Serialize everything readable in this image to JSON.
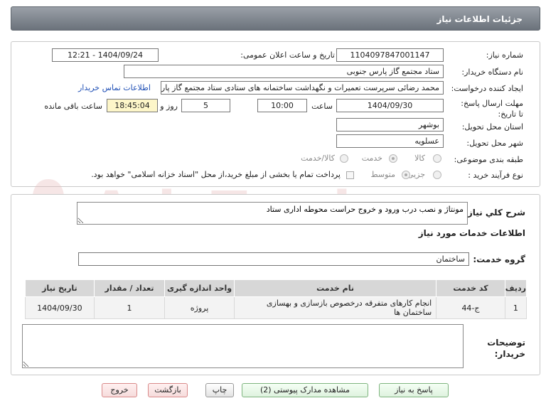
{
  "window": {
    "title": "جزئیات اطلاعات نیاز"
  },
  "fields": {
    "need_number_label": "شماره نیاز:",
    "need_number": "1104097847001147",
    "announce_label": "تاریخ و ساعت اعلان عمومی:",
    "announce_value": "1404/09/24 - 12:21",
    "buyer_org_label": "نام دستگاه خریدار:",
    "buyer_org": "ستاد مجتمع گاز پارس جنوبی",
    "creator_label": "ایجاد کننده درخواست:",
    "creator": "محمد رضائی سرپرست تعمیرات و نگهداشت ساختمانه های ستادی ستاد مجتمع گاز پارس جنوبی",
    "contact_link": "اطلاعات تماس خریدار",
    "deadline_label": "مهلت ارسال پاسخ: تا تاریخ:",
    "deadline_date": "1404/09/30",
    "time_label": "ساعت",
    "deadline_time": "10:00",
    "days_value": "5",
    "days_label": "روز و",
    "remaining_time": "18:45:04",
    "remaining_label": "ساعت باقی مانده",
    "province_label": "استان محل تحویل:",
    "province": "بوشهر",
    "city_label": "شهر محل تحویل:",
    "city": "عسلویه",
    "category_label": "طبقه بندی موضوعی:",
    "category_options": [
      "کالا",
      "خدمت",
      "کالا/خدمت"
    ],
    "category_selected": "خدمت",
    "process_label": "نوع فرآیند خرید :",
    "process_options": [
      "جزیی",
      "متوسط"
    ],
    "process_selected": "متوسط",
    "payment_note": "پرداخت تمام یا بخشی از مبلغ خرید،از محل \"اسناد خزانه اسلامی\" خواهد بود."
  },
  "description": {
    "label": "شرح کلي نياز:",
    "value": "مونتاژ و نصب درب ورود و خروج حراست محوطه اداری ستاد"
  },
  "services": {
    "heading": "اطلاعات خدمات مورد نیاز",
    "group_label": "گروه خدمت:",
    "group_value": "ساختمان",
    "columns": [
      "ردیف",
      "کد خدمت",
      "نام خدمت",
      "واحد اندازه گیری",
      "تعداد / مقدار",
      "تاریخ نیاز"
    ],
    "rows": [
      {
        "row": "1",
        "code": "ج-44",
        "name": "انجام کارهای متفرقه درخصوص بازسازی و بهسازی ساختمان ها",
        "unit": "پروژه",
        "qty": "1",
        "date": "1404/09/30"
      }
    ]
  },
  "buyer_notes": {
    "label": "توضیحات خریدار:",
    "value": ""
  },
  "buttons": {
    "reply": "پاسخ به نیاز",
    "docs": "مشاهده مدارک پیوستی (2)",
    "print": "چاپ",
    "back": "بازگشت",
    "exit": "خروج"
  },
  "watermark": {
    "text": "AriaTender.net"
  },
  "colors": {
    "link": "#1f4fb5",
    "titlebar": "#6b727b",
    "highlight": "#fdf6c9",
    "watermark": "#e8b8b8"
  }
}
